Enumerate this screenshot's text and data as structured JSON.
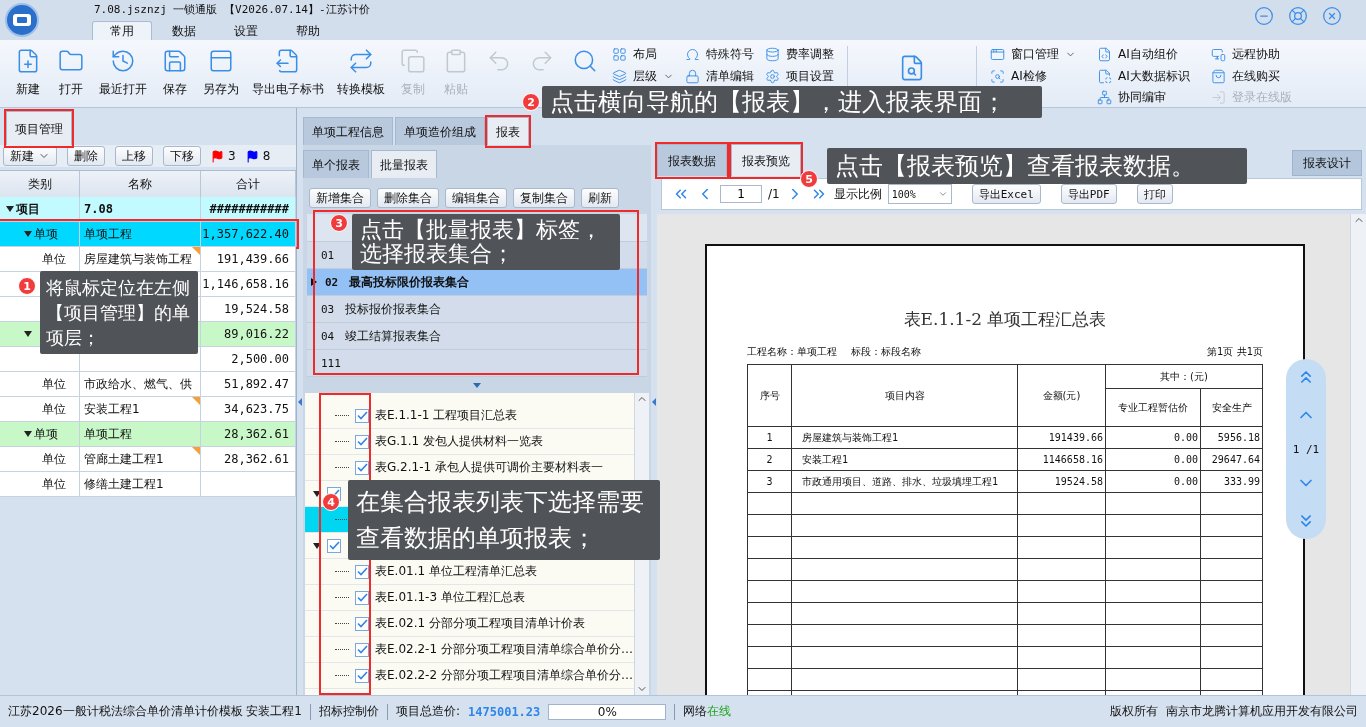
{
  "window": {
    "title": "7.08.jsznzj 一锁通版 【V2026.07.14】-江苏计价",
    "menu_tabs": [
      {
        "label": "常用",
        "selected": true
      },
      {
        "label": "数据",
        "selected": false
      },
      {
        "label": "设置",
        "selected": false
      },
      {
        "label": "帮助",
        "selected": false
      }
    ]
  },
  "ribbon": {
    "buttons": [
      {
        "label": "新建",
        "disabled": false
      },
      {
        "label": "打开",
        "disabled": false
      },
      {
        "label": "最近打开",
        "disabled": false
      },
      {
        "label": "保存",
        "disabled": false
      },
      {
        "label": "另存为",
        "disabled": false
      },
      {
        "label": "导出电子标书",
        "disabled": false
      },
      {
        "label": "转换模板",
        "disabled": false
      },
      {
        "label": "复制",
        "disabled": true
      },
      {
        "label": "粘贴",
        "disabled": true
      },
      {
        "disabled": true
      },
      {
        "disabled": true
      },
      {
        "disabled": false
      }
    ],
    "small_columns": [
      [
        {
          "label": "布局",
          "dropdown": false
        },
        {
          "label": "层级",
          "dropdown": true
        }
      ],
      [
        {
          "label": "特殊符号",
          "dropdown": false
        },
        {
          "label": "清单编辑",
          "dropdown": false
        }
      ],
      [
        {
          "label": "费率调整",
          "dropdown": false
        },
        {
          "label": "项目设置",
          "dropdown": false
        }
      ]
    ],
    "right_columns": [
      [
        {
          "label": "窗口管理",
          "dropdown": true,
          "disabled": false
        },
        {
          "label": "AI检修",
          "dropdown": false,
          "disabled": false
        }
      ],
      [
        {
          "label": "AI自动组价",
          "dropdown": false,
          "disabled": false
        },
        {
          "label": "AI大数据标识",
          "dropdown": false,
          "disabled": false
        },
        {
          "label": "协同编审",
          "dropdown": false,
          "disabled": false
        }
      ],
      [
        {
          "label": "远程协助",
          "dropdown": false,
          "disabled": false
        },
        {
          "label": "在线购买",
          "dropdown": false,
          "disabled": false
        },
        {
          "label": "登录在线版",
          "dropdown": false,
          "disabled": true
        }
      ]
    ]
  },
  "left_panel": {
    "tab": {
      "label": "项目管理",
      "highlighted": true
    },
    "toolbar": [
      {
        "label": "新建",
        "dropdown": true
      },
      {
        "label": "删除",
        "dropdown": false
      },
      {
        "label": "上移",
        "dropdown": false
      },
      {
        "label": "下移",
        "dropdown": false
      }
    ],
    "flags": [
      {
        "color": "#ff0000",
        "count": "3"
      },
      {
        "color": "#0000ff",
        "count": "8"
      }
    ],
    "columns": [
      "类别",
      "名称",
      "合计"
    ],
    "rows": [
      {
        "category": "项目",
        "name": "7.08",
        "total": "###########",
        "selected": false,
        "expanded": true,
        "children": [
          {
            "category": "单项",
            "name": "单项工程",
            "total": "1,357,622.40",
            "selected": true,
            "highlighted": true,
            "expanded": true,
            "children": [
              {
                "category": "单位",
                "name": "房屋建筑与装饰工程",
                "total": "191,439.66",
                "selected": false,
                "marked": true
              },
              {
                "total": "1,146,658.16",
                "selected": false,
                "marked": false
              },
              {
                "total": "19,524.58",
                "selected": false,
                "marked": false
              }
            ]
          },
          {
            "total": "89,016.22",
            "selected": false,
            "expanded": true,
            "children": [
              {
                "total": "2,500.00",
                "selected": false,
                "marked": false
              },
              {
                "category": "单位",
                "name": "市政给水、燃气、供",
                "total": "51,892.47",
                "selected": false,
                "marked": false
              },
              {
                "category": "单位",
                "name": "安装工程1",
                "total": "34,623.75",
                "selected": false,
                "marked": true
              }
            ]
          },
          {
            "category": "单项",
            "name": "单项工程",
            "total": "28,362.61",
            "selected": false,
            "expanded": true,
            "children": [
              {
                "category": "单位",
                "name": "管廊土建工程1",
                "total": "28,362.61",
                "selected": false,
                "marked": true
              },
              {
                "category": "单位",
                "name": "修缮土建工程1",
                "selected": false,
                "marked": false
              }
            ]
          }
        ]
      }
    ]
  },
  "middle_panel": {
    "tabs": [
      {
        "label": "单项工程信息",
        "selected": false,
        "highlighted": false
      },
      {
        "label": "单项造价组成",
        "selected": false,
        "highlighted": false
      },
      {
        "label": "报表",
        "selected": true,
        "highlighted": true
      }
    ],
    "sub_tabs": [
      {
        "label": "单个报表",
        "selected": false
      },
      {
        "label": "批量报表",
        "selected": true
      }
    ],
    "toolbar": [
      "新增集合",
      "删除集合",
      "编辑集合",
      "复制集合",
      "刷新"
    ],
    "report_sets": {
      "highlighted": true,
      "rows": [
        {
          "code": "01",
          "selected": false
        },
        {
          "code": "02",
          "name": "最高投标限价报表集合",
          "selected": true
        },
        {
          "code": "03",
          "name": "投标报价报表集合",
          "selected": false
        },
        {
          "code": "04",
          "name": "竣工结算报表集合",
          "selected": false
        },
        {
          "code": "111",
          "selected": false
        }
      ]
    },
    "report_tree": {
      "highlighted": true,
      "groups": [
        {
          "children": [
            {
              "label": "表E.1.1-1  工程项目汇总表",
              "checked": true,
              "selected": false
            },
            {
              "label": "表G.1.1  发包人提供材料一览表",
              "checked": true,
              "selected": false
            },
            {
              "label": "表G.2.1-1  承包人提供可调价主要材料表一",
              "checked": true,
              "selected": false
            }
          ]
        },
        {
          "checked": true,
          "expanded": true,
          "children": [
            {
              "selected": true
            }
          ]
        },
        {
          "checked": true,
          "expanded": true,
          "children": [
            {
              "label": "表E.01.1  单位工程清单汇总表",
              "checked": true,
              "selected": false
            },
            {
              "label": "表E.01.1-3  单位工程汇总表",
              "checked": true,
              "selected": false
            },
            {
              "label": "表E.02.1  分部分项工程项目清单计价表",
              "checked": true,
              "selected": false
            },
            {
              "label": "表E.02.2-1  分部分项工程项目清单综合单价分…",
              "checked": true,
              "selected": false
            },
            {
              "label": "表E.02.2-2  分部分项工程项目清单综合单价分…",
              "checked": true,
              "selected": false
            }
          ]
        }
      ]
    }
  },
  "right_panel": {
    "tabs": [
      {
        "label": "报表数据",
        "selected": false,
        "highlighted": true
      },
      {
        "label": "报表预览",
        "selected": true,
        "highlighted": true
      }
    ],
    "design_button": "报表设计",
    "toolbar": {
      "page": "1",
      "page_total": "/1",
      "zoom_label": "显示比例",
      "zoom": "100%",
      "buttons": [
        "导出Excel",
        "导出PDF",
        "打印"
      ]
    },
    "preview": {
      "title": "表E.1.1-2  单项工程汇总表",
      "project_name": "工程名称：单项工程",
      "section": "标段：标段名称",
      "page_info": "第1页 共1页",
      "columns": {
        "no": "序号",
        "content": "项目内容",
        "amount": "金额(元)",
        "group": "其中：(元)",
        "sub": [
          "专业工程暂估价",
          "安全生产"
        ]
      },
      "rows": [
        [
          "1",
          "房屋建筑与装饰工程1",
          "191439.66",
          "0.00",
          "5956.18"
        ],
        [
          "2",
          "安装工程1",
          "1146658.16",
          "0.00",
          "29647.64"
        ],
        [
          "3",
          "市政通用项目、道路、排水、垃圾填埋工程1",
          "19524.58",
          "0.00",
          "333.99"
        ]
      ],
      "page_nav": "1 /1"
    }
  },
  "status_bar": {
    "template": "江苏2026一般计税法综合单价清单计价模板 安装工程1",
    "mode": "招标控制价",
    "total_label": "项目总造价:",
    "total": "1475001.23",
    "progress": {
      "level": 0,
      "reading": "0%"
    },
    "network_label": "网络",
    "network": "在线",
    "copyright": "版权所有",
    "company": "南京市龙腾计算机应用开发有限公司"
  },
  "callouts": [
    {
      "number": "1",
      "text": "将鼠标定位在左侧【项目管理】的单项层；"
    },
    {
      "number": "2",
      "text": "点击横向导航的【报表】，进入报表界面；"
    },
    {
      "number": "3",
      "text": "点击【批量报表】标签，选择报表集合；"
    },
    {
      "number": "4",
      "text": "在集合报表列表下选择需要查看数据的单项报表；"
    },
    {
      "number": "5",
      "text": "点击【报表预览】查看报表数据。"
    }
  ]
}
